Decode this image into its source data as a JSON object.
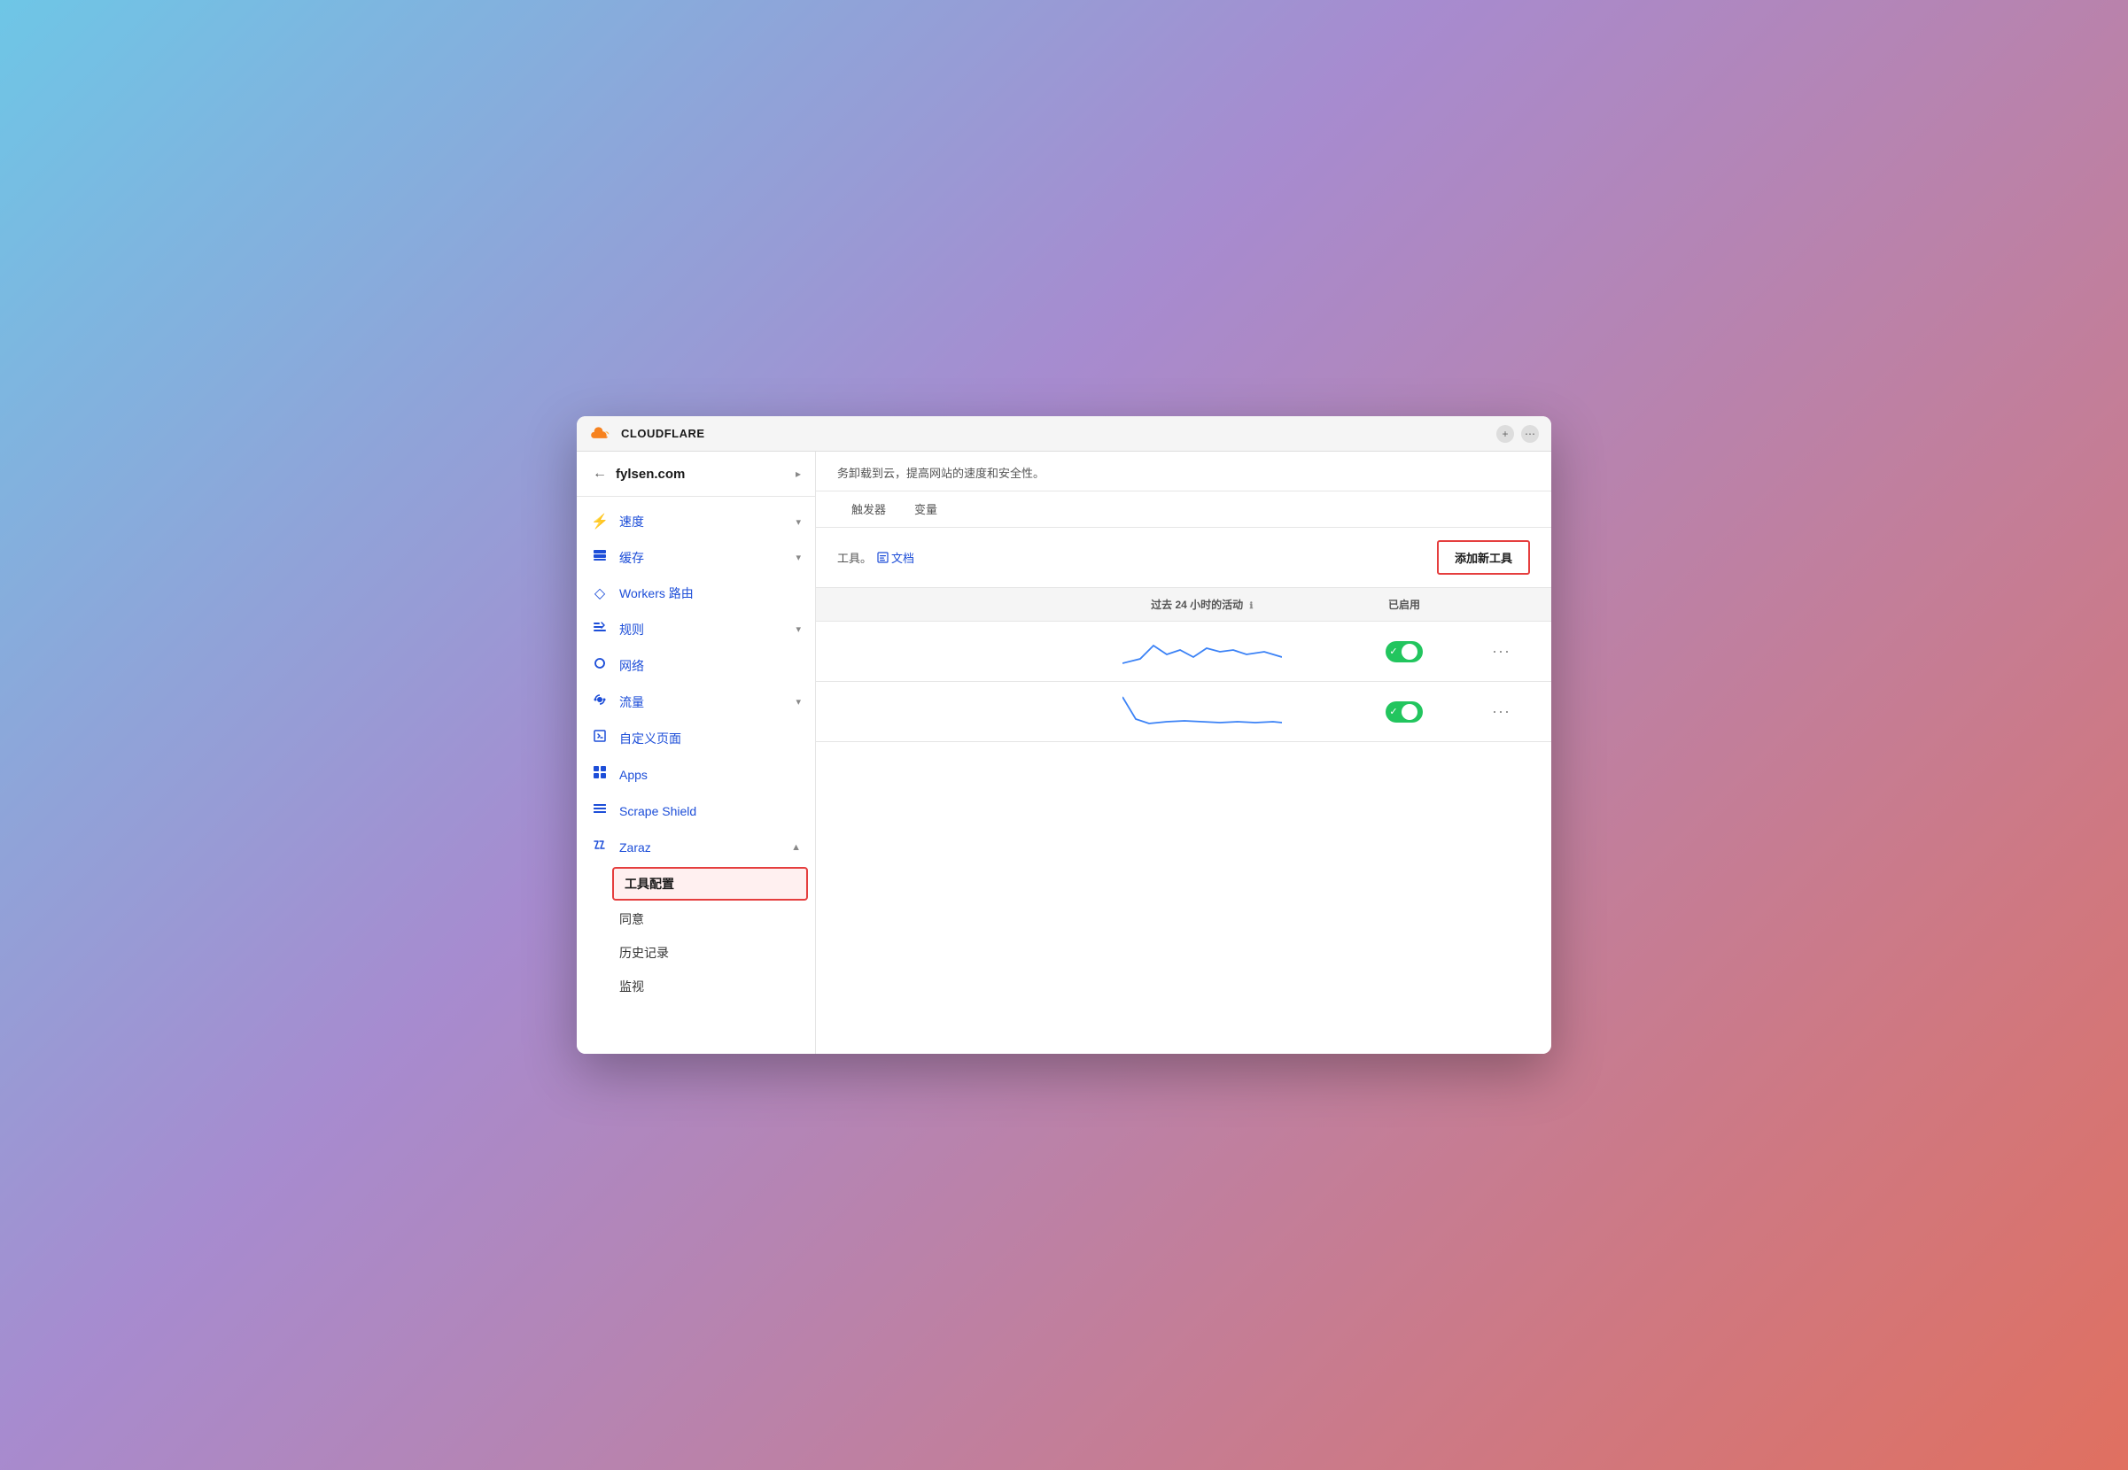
{
  "window": {
    "title": "Cloudflare"
  },
  "logo": {
    "text": "CLOUDFLARE"
  },
  "sidebar": {
    "domain": "fylsen.com",
    "back_label": "←",
    "chevron": "▸",
    "nav_items": [
      {
        "id": "speed",
        "icon": "⚡",
        "label": "速度",
        "arrow": "▾"
      },
      {
        "id": "cache",
        "icon": "🗄",
        "label": "缓存",
        "arrow": "▾"
      },
      {
        "id": "workers",
        "icon": "◇",
        "label": "Workers 路由",
        "arrow": ""
      },
      {
        "id": "rules",
        "icon": "⑂",
        "label": "规则",
        "arrow": "▾"
      },
      {
        "id": "network",
        "icon": "📍",
        "label": "网络",
        "arrow": ""
      },
      {
        "id": "traffic",
        "icon": "⑂",
        "label": "流量",
        "arrow": "▾"
      },
      {
        "id": "custom-pages",
        "icon": "🔧",
        "label": "自定义页面",
        "arrow": ""
      },
      {
        "id": "apps",
        "icon": "⊡",
        "label": "Apps",
        "arrow": ""
      },
      {
        "id": "scrape-shield",
        "icon": "☰",
        "label": "Scrape Shield",
        "arrow": ""
      }
    ],
    "zaraz": {
      "label": "Zaraz",
      "icon": "≡",
      "arrow": "▲",
      "sub_items": [
        {
          "id": "tool-config",
          "label": "工具配置",
          "active": true
        },
        {
          "id": "consent",
          "label": "同意",
          "active": false
        },
        {
          "id": "history",
          "label": "历史记录",
          "active": false
        },
        {
          "id": "monitor",
          "label": "监视",
          "active": false
        }
      ]
    }
  },
  "content": {
    "description": "务卸载到云，提高网站的速度和安全性。",
    "tabs": [
      {
        "id": "trigger",
        "label": "触发器",
        "active": false
      },
      {
        "id": "variables",
        "label": "变量",
        "active": false
      }
    ],
    "tools_description": "工具。",
    "doc_link_icon": "⊡",
    "doc_link_label": "文档",
    "add_tool_label": "添加新工具",
    "table": {
      "headers": [
        {
          "id": "name",
          "label": ""
        },
        {
          "id": "activity",
          "label": "过去 24 小时的活动"
        },
        {
          "id": "enabled",
          "label": "已启用"
        },
        {
          "id": "actions",
          "label": ""
        }
      ],
      "rows": [
        {
          "id": "row1",
          "name": "",
          "enabled": true,
          "dots": "···"
        },
        {
          "id": "row2",
          "name": "",
          "enabled": true,
          "dots": "···"
        }
      ]
    }
  },
  "colors": {
    "accent_blue": "#1d4ed8",
    "accent_red": "#e53e3e",
    "toggle_green": "#22c55e",
    "border": "#e5e5e5",
    "bg_light": "#f5f5f5"
  }
}
